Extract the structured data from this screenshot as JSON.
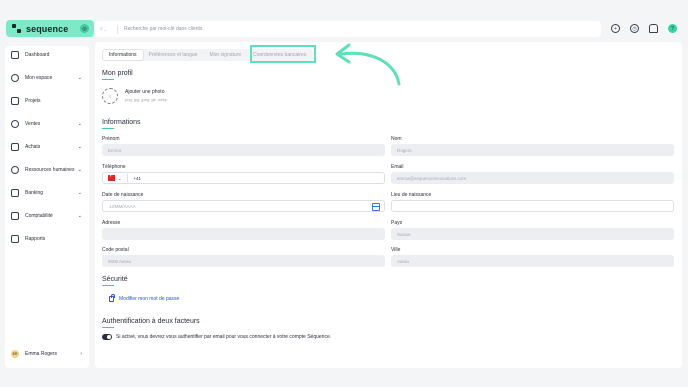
{
  "brand": {
    "name": "sequence",
    "badge": "◎"
  },
  "sidebar": {
    "items": [
      {
        "label": "Dashboard",
        "icon": "home-icon",
        "chevron": ""
      },
      {
        "label": "Mon espace",
        "icon": "user-icon",
        "chevron": "⌄"
      },
      {
        "label": "Projets",
        "icon": "check-square-icon",
        "chevron": ""
      },
      {
        "label": "Ventes",
        "icon": "money-bag-icon",
        "chevron": "⌄"
      },
      {
        "label": "Achats",
        "icon": "shopping-bag-icon",
        "chevron": "⌄"
      },
      {
        "label": "Ressources humaines",
        "icon": "people-icon",
        "chevron": "⌄"
      },
      {
        "label": "Banking",
        "icon": "wallet-icon",
        "chevron": "⌄"
      },
      {
        "label": "Comptabilité",
        "icon": "ledger-icon",
        "chevron": "⌄"
      },
      {
        "label": "Rapports",
        "icon": "chart-icon",
        "chevron": ""
      }
    ],
    "user": {
      "initials": "ER",
      "name": "Emma Rogers",
      "chevron": "›"
    }
  },
  "topbar": {
    "search_scope": "⌕ ⌄",
    "search_placeholder": "Recherche par mot-clé dans clients",
    "icons": [
      {
        "name": "add-icon",
        "glyph": "+"
      },
      {
        "name": "clock-icon",
        "glyph": "◷"
      },
      {
        "name": "bell-icon",
        "glyph": ""
      },
      {
        "name": "help-icon",
        "glyph": "?"
      }
    ]
  },
  "tabs": [
    {
      "label": "Informations",
      "active": true
    },
    {
      "label": "Préférences et langue",
      "active": false
    },
    {
      "label": "Mon signature",
      "active": false
    },
    {
      "label": "Coordonnées bancaires",
      "active": false
    }
  ],
  "profile": {
    "title": "Mon profil",
    "add_photo": "Ajouter une photo",
    "photo_hint": "png, jpg, jpeg, gif, webp",
    "photo_glyph": "⇪"
  },
  "info": {
    "title": "Informations",
    "prenom": {
      "label": "Prénom",
      "value": "Emma"
    },
    "nom": {
      "label": "Nom",
      "value": "Rogers"
    },
    "telephone": {
      "label": "Téléphone",
      "value": "+41",
      "chevron": "⌄"
    },
    "email": {
      "label": "Email",
      "value": "emma@sequenceinnovations.com"
    },
    "date_naissance": {
      "label": "Date de naissance",
      "placeholder": "JJ/MM/AAAA"
    },
    "lieu_naissance": {
      "label": "Lieu de naissance",
      "value": ""
    },
    "adresse": {
      "label": "Adresse",
      "value": ""
    },
    "pays": {
      "label": "Pays",
      "value": "Suisse"
    },
    "code_postal": {
      "label": "Code postal",
      "value": "5000 Aarau"
    },
    "ville": {
      "label": "Ville",
      "value": "Aarau"
    }
  },
  "security": {
    "title": "Sécurité",
    "change_password": "Modifier mon mot de passe"
  },
  "twofa": {
    "title": "Authentification à deux facteurs",
    "enabled": true,
    "description": "Si activé, vous devrez vous authentifier par email pour vous connecter à votre compte Séquence."
  },
  "colors": {
    "brand": "#7ee8c7",
    "highlight": "#5fe0b7",
    "link": "#2b55c9"
  }
}
